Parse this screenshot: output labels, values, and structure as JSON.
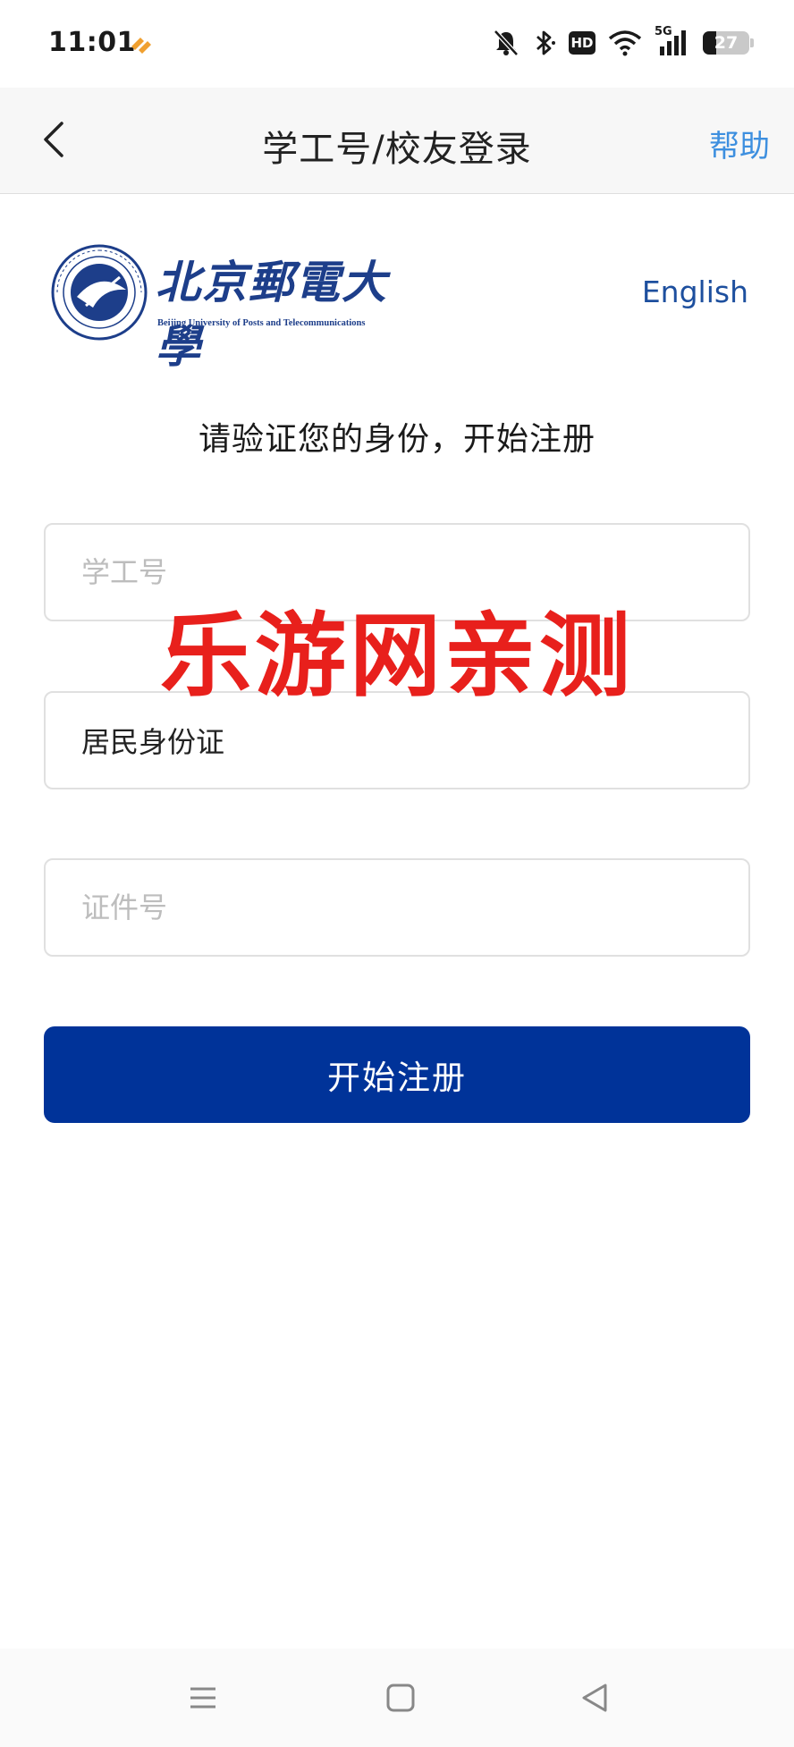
{
  "status_bar": {
    "time": "11:01",
    "hd_label": "HD",
    "network_label": "5G",
    "battery_level": "27"
  },
  "nav": {
    "title": "学工号/校友登录",
    "help_label": "帮助"
  },
  "logo": {
    "name_zh": "北京郵電大學",
    "name_en": "Beijing University of Posts and Telecommunications"
  },
  "language_link": "English",
  "subtitle": "请验证您的身份，开始注册",
  "form": {
    "student_id_placeholder": "学工号",
    "id_type_value": "居民身份证",
    "id_number_placeholder": "证件号",
    "submit_label": "开始注册"
  },
  "watermark_text": "乐游网亲测",
  "colors": {
    "primary_button": "#003399",
    "link_blue": "#3d8fdf",
    "watermark_red": "#e8201c"
  }
}
